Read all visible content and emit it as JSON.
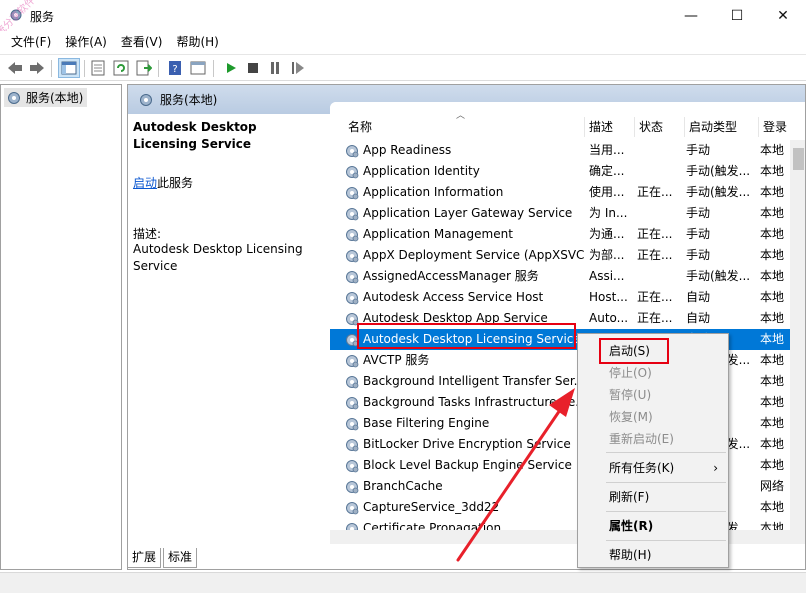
{
  "window": {
    "title": "服务",
    "minimize_glyph": "—",
    "maximize_glyph": "☐",
    "close_glyph": "✕",
    "watermark": "系统分享软件"
  },
  "menubar": {
    "file": "文件(F)",
    "action": "操作(A)",
    "view": "查看(V)",
    "help": "帮助(H)"
  },
  "tree": {
    "root": "服务(本地)"
  },
  "main": {
    "header": "服务(本地)",
    "detail": {
      "title": "Autodesk Desktop Licensing Service",
      "start_link": "启动",
      "start_suffix": "此服务",
      "desc_label": "描述:",
      "desc": "Autodesk Desktop Licensing Service"
    },
    "columns": {
      "name": "名称",
      "desc": "描述",
      "status": "状态",
      "startup": "启动类型",
      "logon": "登录"
    },
    "rows": [
      {
        "name": "App Readiness",
        "desc": "当用...",
        "status": "",
        "startup": "手动",
        "logon": "本地"
      },
      {
        "name": "Application Identity",
        "desc": "确定...",
        "status": "",
        "startup": "手动(触发...",
        "logon": "本地"
      },
      {
        "name": "Application Information",
        "desc": "使用...",
        "status": "正在...",
        "startup": "手动(触发...",
        "logon": "本地"
      },
      {
        "name": "Application Layer Gateway Service",
        "desc": "为 In...",
        "status": "",
        "startup": "手动",
        "logon": "本地"
      },
      {
        "name": "Application Management",
        "desc": "为通...",
        "status": "正在...",
        "startup": "手动",
        "logon": "本地"
      },
      {
        "name": "AppX Deployment Service (AppXSVC)",
        "desc": "为部...",
        "status": "正在...",
        "startup": "手动",
        "logon": "本地"
      },
      {
        "name": "AssignedAccessManager 服务",
        "desc": "Assi...",
        "status": "",
        "startup": "手动(触发...",
        "logon": "本地"
      },
      {
        "name": "Autodesk Access Service Host",
        "desc": "Host...",
        "status": "正在...",
        "startup": "自动",
        "logon": "本地"
      },
      {
        "name": "Autodesk Desktop App Service",
        "desc": "Auto...",
        "status": "正在...",
        "startup": "自动",
        "logon": "本地"
      },
      {
        "name": "Autodesk Desktop Licensing Service",
        "desc": "Auto...",
        "status": "",
        "startup": "自动",
        "logon": "本地"
      },
      {
        "name": "AVCTP 服务",
        "desc": "",
        "status": "",
        "startup": "手动(触发...",
        "logon": "本地"
      },
      {
        "name": "Background Intelligent Transfer Ser...",
        "desc": "",
        "status": "",
        "startup": "",
        "logon": "本地"
      },
      {
        "name": "Background Tasks Infrastructure Se...",
        "desc": "",
        "status": "",
        "startup": "",
        "logon": "本地"
      },
      {
        "name": "Base Filtering Engine",
        "desc": "",
        "status": "",
        "startup": "",
        "logon": "本地"
      },
      {
        "name": "BitLocker Drive Encryption Service",
        "desc": "",
        "status": "",
        "startup": "手动(触发...",
        "logon": "本地"
      },
      {
        "name": "Block Level Backup Engine Service",
        "desc": "",
        "status": "",
        "startup": "",
        "logon": "本地"
      },
      {
        "name": "BranchCache",
        "desc": "",
        "status": "",
        "startup": "",
        "logon": "网络"
      },
      {
        "name": "CaptureService_3dd22",
        "desc": "",
        "status": "",
        "startup": "",
        "logon": "本地"
      },
      {
        "name": "Certificate Propagation",
        "desc": "",
        "status": "",
        "startup": "手动(触发...",
        "logon": "本地"
      }
    ]
  },
  "tabs": {
    "extended": "扩展",
    "standard": "标准"
  },
  "context_menu": {
    "start": "启动(S)",
    "stop": "停止(O)",
    "pause": "暂停(U)",
    "resume": "恢复(M)",
    "restart": "重新启动(E)",
    "all_tasks": "所有任务(K)",
    "submenu_arrow": "›",
    "refresh": "刷新(F)",
    "properties": "属性(R)",
    "help": "帮助(H)"
  },
  "colors": {
    "selection": "#0078d7",
    "annotation_red": "#e60012",
    "header_blue": "#c4d4e8"
  }
}
